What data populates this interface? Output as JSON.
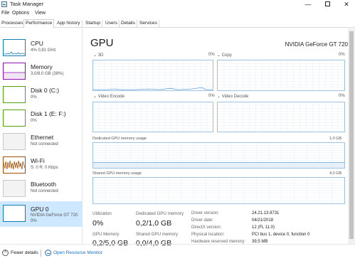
{
  "window": {
    "title": "Task Manager",
    "icon": "task-manager-icon",
    "controls": {
      "minimize": "—",
      "maximize": "max-box",
      "close": "✕"
    }
  },
  "menu": [
    "File",
    "Options",
    "View"
  ],
  "tabs": [
    "Processes",
    "Performance",
    "App history",
    "Startup",
    "Users",
    "Details",
    "Services"
  ],
  "active_tab": "Performance",
  "sidebar": {
    "items": [
      {
        "name": "CPU",
        "sub": "4% 0,81 GHz",
        "color": "#117dbb"
      },
      {
        "name": "Memory",
        "sub": "3,0/8,0 GB (38%)",
        "color": "#8b12ae"
      },
      {
        "name": "Disk 0 (C:)",
        "sub": "0%",
        "color": "#4da60c"
      },
      {
        "name": "Disk 1 (E: F:)",
        "sub": "0%",
        "color": "#4da60c"
      },
      {
        "name": "Ethernet",
        "sub": "Not connected",
        "color": "#a74f01"
      },
      {
        "name": "Wi-Fi",
        "sub": "S: 0 R: 0 Kbps",
        "color": "#a74f01"
      },
      {
        "name": "Bluetooth",
        "sub": "Not connected",
        "color": "#a74f01"
      },
      {
        "name": "GPU 0",
        "sub": "NVIDIA GeForce GT 720",
        "sub2": "0%",
        "color": "#117dbb"
      }
    ],
    "selected": "GPU 0"
  },
  "main": {
    "title": "GPU",
    "model": "NVIDIA GeForce GT 720",
    "graphs": {
      "3d": {
        "label": "3D",
        "percent": "0%"
      },
      "copy": {
        "label": "Copy",
        "percent": "0%"
      },
      "video_encode": {
        "label": "Video Encode",
        "percent": "0%"
      },
      "video_decode": {
        "label": "Video Decode",
        "percent": "0%"
      },
      "dedicated": {
        "label": "Dedicated GPU memory usage",
        "max": "1,0 GB"
      },
      "shared": {
        "label": "Shared GPU memory usage",
        "max": "4,0 GB"
      }
    },
    "stats": {
      "utilization": {
        "label": "Utilization",
        "value": "0%"
      },
      "dedicated_memory": {
        "label": "Dedicated GPU memory",
        "value": "0,2/1,0 GB"
      },
      "gpu_memory": {
        "label": "GPU Memory",
        "value": "0,2/5,0 GB"
      },
      "shared_memory": {
        "label": "Shared GPU memory",
        "value": "0,0/4,0 GB"
      }
    },
    "details": [
      {
        "label": "Driver version:",
        "value": "24.21.13.9731"
      },
      {
        "label": "Driver date:",
        "value": "04/21/2018"
      },
      {
        "label": "DirectX version:",
        "value": "12 (FL 11.0)"
      },
      {
        "label": "Physical location:",
        "value": "PCI bus 1, device 0, function 0"
      },
      {
        "label": "Hardware reserved memory:",
        "value": "39,5 MB"
      }
    ]
  },
  "footer": {
    "fewer_details": "Fewer details",
    "open_resource_monitor": "Open Resource Monitor"
  }
}
